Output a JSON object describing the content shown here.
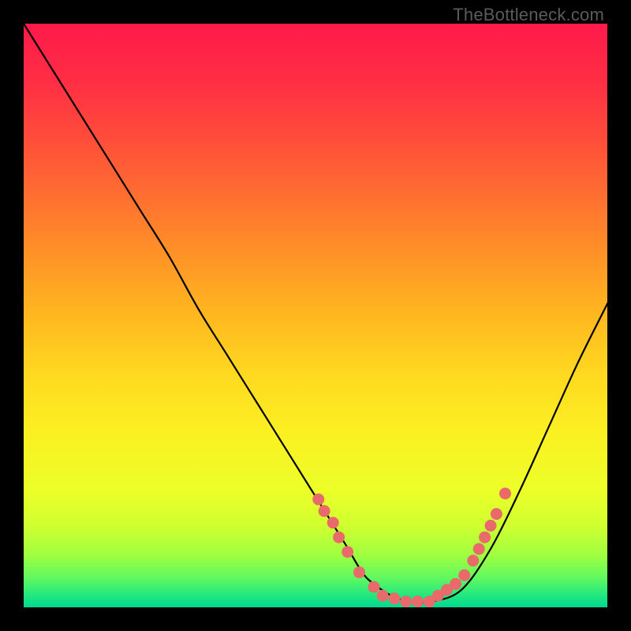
{
  "watermark": "TheBottleneck.com",
  "chart_data": {
    "type": "line",
    "title": "",
    "xlabel": "",
    "ylabel": "",
    "xlim": [
      0,
      100
    ],
    "ylim": [
      0,
      100
    ],
    "series": [
      {
        "name": "curve",
        "x": [
          0,
          5,
          10,
          15,
          20,
          25,
          30,
          35,
          40,
          45,
          50,
          55,
          58,
          60,
          63,
          66,
          70,
          75,
          80,
          85,
          90,
          95,
          100
        ],
        "y": [
          100,
          92,
          84,
          76,
          68,
          60,
          51,
          43,
          35,
          27,
          19,
          11,
          6,
          4,
          2,
          1,
          1,
          3,
          10,
          20,
          31,
          42,
          52
        ]
      }
    ],
    "markers": [
      {
        "x": 50.5,
        "y": 18.5
      },
      {
        "x": 51.5,
        "y": 16.5
      },
      {
        "x": 53.0,
        "y": 14.5
      },
      {
        "x": 54.0,
        "y": 12.0
      },
      {
        "x": 55.5,
        "y": 9.5
      },
      {
        "x": 57.5,
        "y": 6.0
      },
      {
        "x": 60.0,
        "y": 3.5
      },
      {
        "x": 61.5,
        "y": 2.0
      },
      {
        "x": 63.5,
        "y": 1.5
      },
      {
        "x": 65.5,
        "y": 1.0
      },
      {
        "x": 67.5,
        "y": 1.0
      },
      {
        "x": 69.5,
        "y": 1.0
      },
      {
        "x": 71.0,
        "y": 2.0
      },
      {
        "x": 72.5,
        "y": 3.0
      },
      {
        "x": 74.0,
        "y": 4.0
      },
      {
        "x": 75.5,
        "y": 5.5
      },
      {
        "x": 77.0,
        "y": 8.0
      },
      {
        "x": 78.0,
        "y": 10.0
      },
      {
        "x": 79.0,
        "y": 12.0
      },
      {
        "x": 80.0,
        "y": 14.0
      },
      {
        "x": 81.0,
        "y": 16.0
      },
      {
        "x": 82.5,
        "y": 19.5
      }
    ],
    "gradient_stops": [
      {
        "offset": 0,
        "color": "#ff1a4a"
      },
      {
        "offset": 0.1,
        "color": "#ff2e44"
      },
      {
        "offset": 0.2,
        "color": "#ff4e3a"
      },
      {
        "offset": 0.3,
        "color": "#ff7030"
      },
      {
        "offset": 0.4,
        "color": "#ff9426"
      },
      {
        "offset": 0.5,
        "color": "#ffb820"
      },
      {
        "offset": 0.6,
        "color": "#ffd820"
      },
      {
        "offset": 0.7,
        "color": "#fbf022"
      },
      {
        "offset": 0.8,
        "color": "#ecff28"
      },
      {
        "offset": 0.86,
        "color": "#d0ff30"
      },
      {
        "offset": 0.91,
        "color": "#a0ff40"
      },
      {
        "offset": 0.95,
        "color": "#60f860"
      },
      {
        "offset": 0.98,
        "color": "#20e880"
      },
      {
        "offset": 1.0,
        "color": "#00d890"
      }
    ],
    "marker_color": "#e86a6a",
    "curve_color": "#000000"
  }
}
